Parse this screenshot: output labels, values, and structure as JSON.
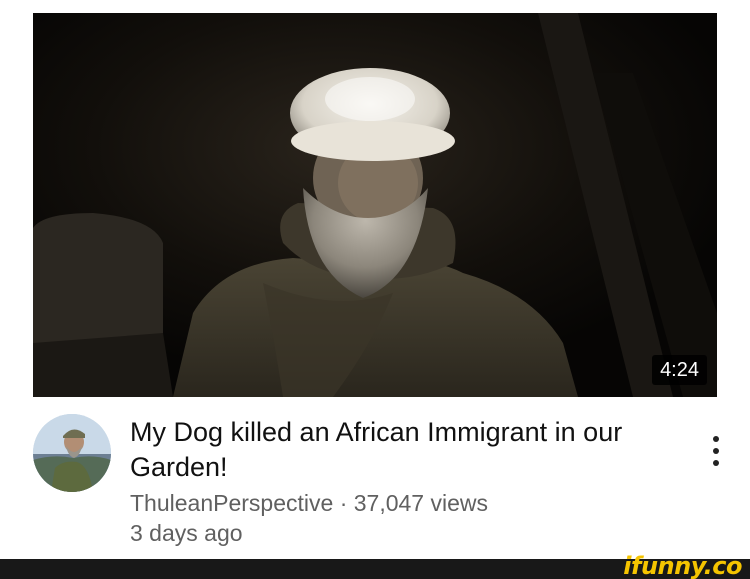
{
  "video": {
    "duration": "4:24",
    "title": "My Dog killed an African Immigrant in our Garden!"
  },
  "channel": {
    "name": "ThuleanPerspective",
    "views": "37,047 views",
    "age": "3 days ago"
  },
  "meta_separator": "·",
  "watermark": {
    "text": "ifunny.co"
  },
  "colors": {
    "title": "#111111",
    "meta": "#606060",
    "watermark": "#f5c400",
    "footer_bar": "#181818"
  },
  "icons": {
    "more": "vertical-ellipsis-icon"
  }
}
